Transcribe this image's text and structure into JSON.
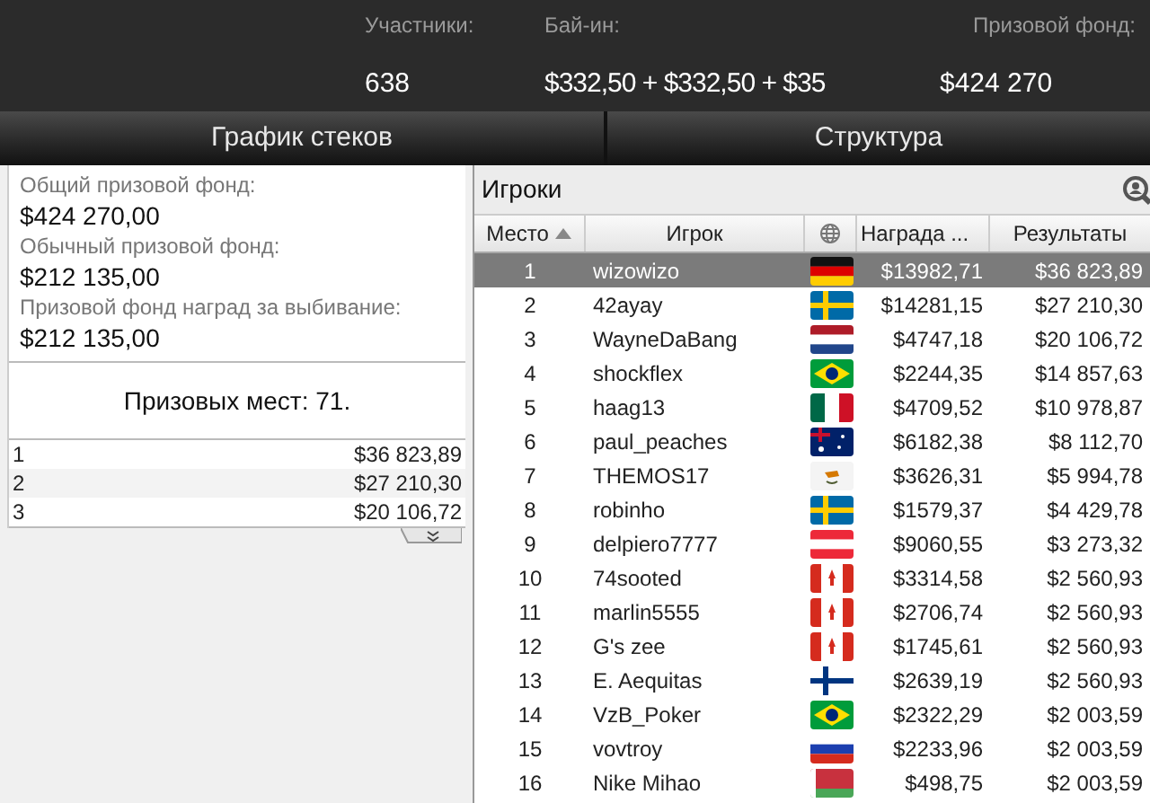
{
  "summary": {
    "entrants_label": "Участники:",
    "entrants": "638",
    "buyin_label": "Бай-ин:",
    "buyin": "$332,50 + $332,50 + $35",
    "prizepool_label": "Призовой фонд:",
    "prizepool": "$424 270"
  },
  "tabs": [
    {
      "label": "График стеков",
      "selected": false
    },
    {
      "label": "Структура",
      "selected": false
    }
  ],
  "prize_info": [
    {
      "label": "Общий призовой фонд:",
      "value": "$424 270,00"
    },
    {
      "label": "Обычный призовой фонд:",
      "value": "$212 135,00"
    },
    {
      "label": "Призовой фонд наград за выбивание:",
      "value": "$212 135,00"
    }
  ],
  "paid_places": "Призовых мест: 71.",
  "payouts": [
    {
      "place": "1",
      "amount": "$36 823,89"
    },
    {
      "place": "2",
      "amount": "$27 210,30"
    },
    {
      "place": "3",
      "amount": "$20 106,72"
    }
  ],
  "players": {
    "title": "Игроки",
    "columns": [
      "Место",
      "Игрок",
      "Награда ...",
      "Результаты"
    ],
    "rows": [
      {
        "place": "1",
        "name": "wizowizo",
        "kind": "germany",
        "bounty": "$13982,71",
        "result": "$36 823,89",
        "selected": true
      },
      {
        "place": "2",
        "name": "42ayay",
        "kind": "sweden",
        "bounty": "$14281,15",
        "result": "$27 210,30",
        "selected": false
      },
      {
        "place": "3",
        "name": "WayneDaBang",
        "kind": "netherlands",
        "bounty": "$4747,18",
        "result": "$20 106,72",
        "selected": false
      },
      {
        "place": "4",
        "name": "shockflex",
        "kind": "brazil",
        "bounty": "$2244,35",
        "result": "$14 857,63",
        "selected": false
      },
      {
        "place": "5",
        "name": "haag13",
        "kind": "mexico",
        "bounty": "$4709,52",
        "result": "$10 978,87",
        "selected": false
      },
      {
        "place": "6",
        "name": "paul_peaches",
        "kind": "australia",
        "bounty": "$6182,38",
        "result": "$8 112,70",
        "selected": false
      },
      {
        "place": "7",
        "name": "THEMOS17",
        "kind": "cyprus",
        "bounty": "$3626,31",
        "result": "$5 994,78",
        "selected": false
      },
      {
        "place": "8",
        "name": "robinho",
        "kind": "sweden",
        "bounty": "$1579,37",
        "result": "$4 429,78",
        "selected": false
      },
      {
        "place": "9",
        "name": "delpiero7777",
        "kind": "austria",
        "bounty": "$9060,55",
        "result": "$3 273,32",
        "selected": false
      },
      {
        "place": "10",
        "name": "74sooted",
        "kind": "canada",
        "bounty": "$3314,58",
        "result": "$2 560,93",
        "selected": false
      },
      {
        "place": "11",
        "name": "marlin5555",
        "kind": "canada",
        "bounty": "$2706,74",
        "result": "$2 560,93",
        "selected": false
      },
      {
        "place": "12",
        "name": "G's zee",
        "kind": "canada",
        "bounty": "$1745,61",
        "result": "$2 560,93",
        "selected": false
      },
      {
        "place": "13",
        "name": "E. Aequitas",
        "kind": "finland",
        "bounty": "$2639,19",
        "result": "$2 560,93",
        "selected": false
      },
      {
        "place": "14",
        "name": "VzB_Poker",
        "kind": "brazil",
        "bounty": "$2322,29",
        "result": "$2 003,59",
        "selected": false
      },
      {
        "place": "15",
        "name": "vovtroy",
        "kind": "russia",
        "bounty": "$2233,96",
        "result": "$2 003,59",
        "selected": false
      },
      {
        "place": "16",
        "name": "Nike Mihao",
        "kind": "belarus",
        "bounty": "$498,75",
        "result": "$2 003,59",
        "selected": false
      }
    ]
  }
}
